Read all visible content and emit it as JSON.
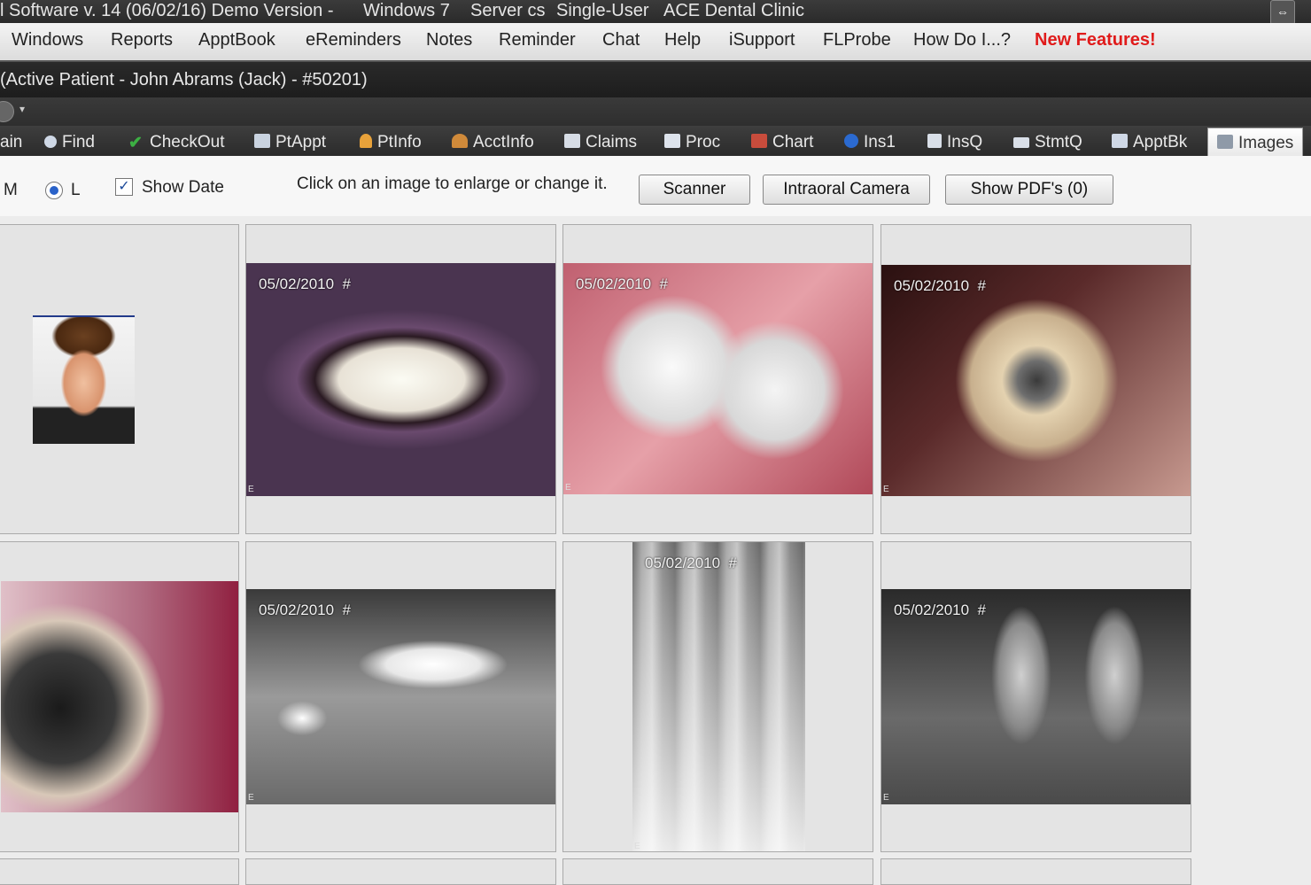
{
  "titlebar": {
    "segments": [
      "l Software v. 14 (06/02/16) Demo Version -",
      "Windows 7",
      "Server cs",
      "Single-User",
      "ACE Dental Clinic"
    ]
  },
  "menu": {
    "items": [
      "Windows",
      "Reports",
      "ApptBook",
      "eReminders",
      "Notes",
      "Reminder",
      "Chat",
      "Help",
      "iSupport",
      "FLProbe",
      "How Do I...?"
    ],
    "new_features": "New Features!"
  },
  "patient": {
    "label": "(Active Patient - John Abrams (Jack) - #50201)"
  },
  "tabs": [
    {
      "label": "ain"
    },
    {
      "label": "Find",
      "icon": "magnifier-icon"
    },
    {
      "label": "CheckOut",
      "icon": "checkmark-icon"
    },
    {
      "label": "PtAppt",
      "icon": "appointment-icon"
    },
    {
      "label": "PtInfo",
      "icon": "person-icon"
    },
    {
      "label": "AcctInfo",
      "icon": "people-icon"
    },
    {
      "label": "Claims",
      "icon": "form-icon"
    },
    {
      "label": "Proc",
      "icon": "pencil-icon"
    },
    {
      "label": "Chart",
      "icon": "chart-icon"
    },
    {
      "label": "Ins1",
      "icon": "info-icon"
    },
    {
      "label": "InsQ",
      "icon": "list-icon"
    },
    {
      "label": "StmtQ",
      "icon": "statement-icon"
    },
    {
      "label": "ApptBk",
      "icon": "calendar-icon"
    },
    {
      "label": "Images",
      "icon": "camera-icon"
    }
  ],
  "toolbar": {
    "size_m": "M",
    "size_l": "L",
    "show_date": "Show Date",
    "hint": "Click on an image to enlarge or change it.",
    "scanner": "Scanner",
    "intraoral": "Intraoral Camera",
    "show_pdfs": "Show PDF's (0)"
  },
  "images": {
    "date": "05/02/2010",
    "hash": "#",
    "edge_mark": "E"
  },
  "colors": {
    "accent_red": "#e01b1b",
    "dark_bar": "#2b2b2b"
  }
}
